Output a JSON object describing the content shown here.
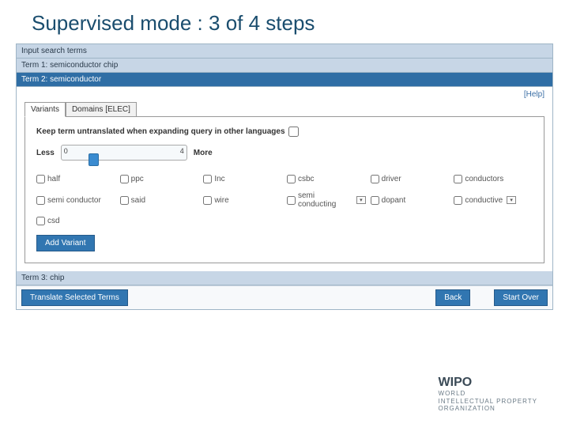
{
  "slide_title": "Supervised mode : 3 of 4 steps",
  "header_input": "Input search terms",
  "term1": "Term 1: semiconductor chip",
  "term2": "Term 2: semiconductor",
  "term3": "Term 3: chip",
  "help": "[Help]",
  "tabs": {
    "variants": "Variants",
    "domains": "Domains [ELEC]"
  },
  "keep_label": "Keep term untranslated when expanding query in other languages",
  "slider": {
    "less": "Less",
    "more": "More",
    "min": "0",
    "max": "4"
  },
  "variants": {
    "r0": [
      "half",
      "ppc",
      "Inc",
      "csbc",
      "driver",
      "conductors"
    ],
    "r1": [
      "semi conductor",
      "said",
      "wire",
      "semi conducting",
      "dopant",
      "conductive"
    ],
    "r2": [
      "csd",
      "",
      "",
      "",
      "",
      ""
    ]
  },
  "dropdown_idx": {
    "r1c3": true,
    "r1c5": true
  },
  "add_variant": "Add Variant",
  "buttons": {
    "translate": "Translate Selected Terms",
    "back": "Back",
    "start_over": "Start Over"
  },
  "logo": {
    "brand": "WIPO",
    "l1": "WORLD",
    "l2": "INTELLECTUAL PROPERTY",
    "l3": "ORGANIZATION"
  }
}
